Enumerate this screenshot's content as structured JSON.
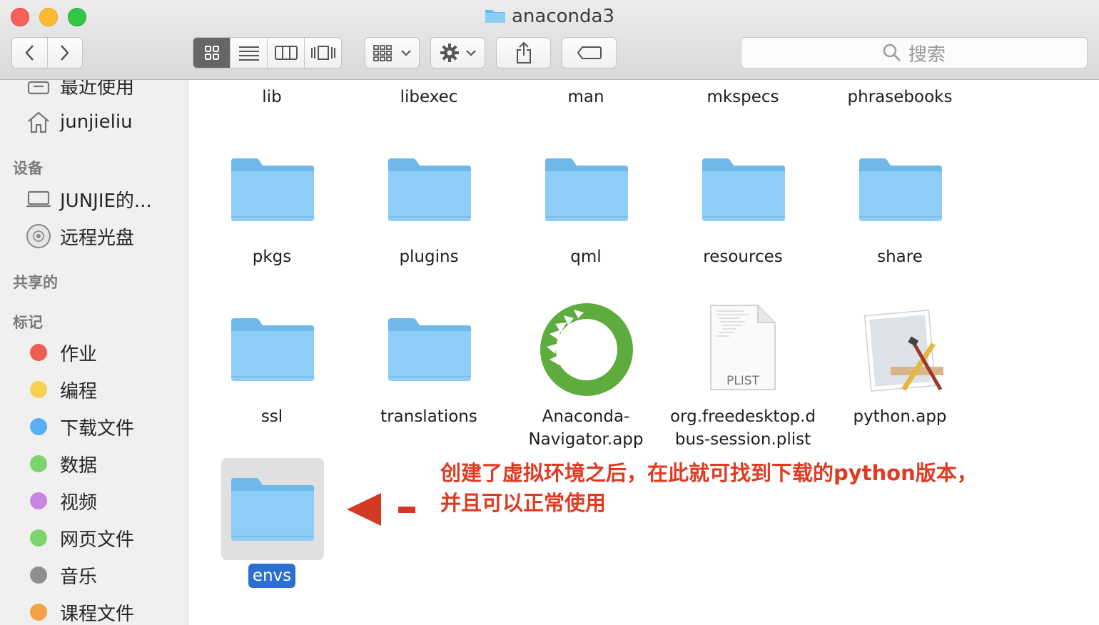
{
  "window": {
    "title": "anaconda3",
    "controls": [
      "close",
      "minimize",
      "zoom"
    ]
  },
  "toolbar": {
    "back_icon": "chevron-left-icon",
    "forward_icon": "chevron-right-icon",
    "view_modes": [
      "icon-view-icon",
      "list-view-icon",
      "column-view-icon",
      "cover-flow-icon"
    ],
    "active_view": "icon-view-icon",
    "arrange_icon": "grid-arrange-icon",
    "action_icon": "gear-icon",
    "share_icon": "share-icon",
    "tag_icon": "tag-icon",
    "search_placeholder": "搜索"
  },
  "sidebar": {
    "top_items": [
      {
        "label": "最近使用",
        "icon": "recents-icon"
      },
      {
        "label": "junjieliu",
        "icon": "home-icon"
      }
    ],
    "devices_heading": "设备",
    "devices": [
      {
        "label": "JUNJIE的...",
        "icon": "laptop-icon"
      },
      {
        "label": "远程光盘",
        "icon": "disc-icon"
      }
    ],
    "shared_heading": "共享的",
    "tags_heading": "标记",
    "tags": [
      {
        "label": "作业",
        "color": "#f25a54"
      },
      {
        "label": "编程",
        "color": "#f9cf50"
      },
      {
        "label": "下载文件",
        "color": "#5aaef6"
      },
      {
        "label": "数据",
        "color": "#7cd46a"
      },
      {
        "label": "视频",
        "color": "#c986e0"
      },
      {
        "label": "网页文件",
        "color": "#7cd46a"
      },
      {
        "label": "音乐",
        "color": "#8f8f8f"
      },
      {
        "label": "课程文件",
        "color": "#f4a245"
      }
    ]
  },
  "files": {
    "row1": [
      "lib",
      "libexec",
      "man",
      "mkspecs",
      "phrasebooks"
    ],
    "row2": [
      "pkgs",
      "plugins",
      "qml",
      "resources",
      "share"
    ],
    "row3": [
      {
        "name": "ssl",
        "kind": "folder"
      },
      {
        "name": "translations",
        "kind": "folder"
      },
      {
        "name": "Anaconda-\nNavigator.app",
        "line1": "Anaconda-",
        "line2": "Navigator.app",
        "kind": "anaconda-app-icon"
      },
      {
        "name": "org.freedesktop.dbus-session.plist",
        "line1": "org.freedesktop.d",
        "line2": "bus-session.plist",
        "kind": "plist-file-icon",
        "badge": "PLIST"
      },
      {
        "name": "python.app",
        "kind": "python-app-icon"
      }
    ],
    "selected": "envs"
  },
  "annotation": {
    "line1": "创建了虚拟环境之后，在此就可找到下载的python版本，",
    "line2": "并且可以正常使用",
    "color": "#e03a22"
  }
}
